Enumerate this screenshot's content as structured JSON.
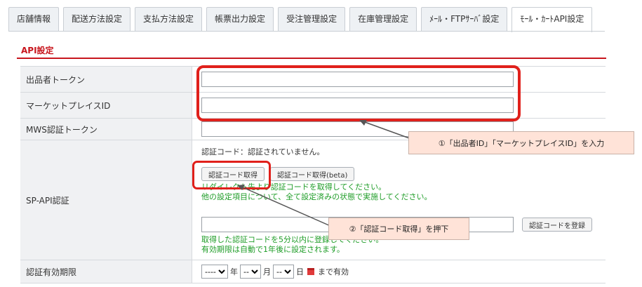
{
  "tabs": [
    {
      "label": "店舗情報",
      "active": false
    },
    {
      "label": "配送方法設定",
      "active": false
    },
    {
      "label": "支払方法設定",
      "active": false
    },
    {
      "label": "帳票出力設定",
      "active": false
    },
    {
      "label": "受注管理設定",
      "active": false
    },
    {
      "label": "在庫管理設定",
      "active": false
    },
    {
      "label": "ﾒｰﾙ・FTPｻｰﾊﾞ設定",
      "active": false
    },
    {
      "label": "ﾓｰﾙ・ｶｰﾄAPI設定",
      "active": true
    }
  ],
  "section_title": "API設定",
  "fields": {
    "seller_token": {
      "label": "出品者トークン",
      "value": ""
    },
    "marketplace_id": {
      "label": "マーケットプレイスID",
      "value": ""
    },
    "mws_token": {
      "label": "MWS認証トークン",
      "value": ""
    }
  },
  "sp_api": {
    "label": "SP-API認証",
    "status": "認証コード：認証されていません。",
    "btn_get_code": "認証コード取得",
    "btn_get_code_beta": "認証コード取得(beta)",
    "note1": "リダイレクト先より認証コードを取得してください。",
    "note2": "他の設定項目について、全て設定済みの状態で実施してください。",
    "code_value": "",
    "btn_register": "認証コードを登録",
    "note3": "取得した認証コードを5分以内に登録してください。",
    "note4": "有効期限は自動で1年後に設定されます。"
  },
  "expiry": {
    "label": "認証有効期限",
    "year_value": "----",
    "year_unit": "年",
    "month_value": "--",
    "month_unit": "月",
    "day_value": "--",
    "day_unit": "日",
    "suffix": "まで有効"
  },
  "annotations": {
    "callout1": "①「出品者ID」「マーケットプレイスID」を入力",
    "callout2": "②「認証コード取得」を押下",
    "highlight_color": "#e0201b",
    "callout_bg": "#ffe3d8"
  },
  "colors": {
    "accent_red": "#c8161d",
    "note_green": "#1f9d28"
  }
}
